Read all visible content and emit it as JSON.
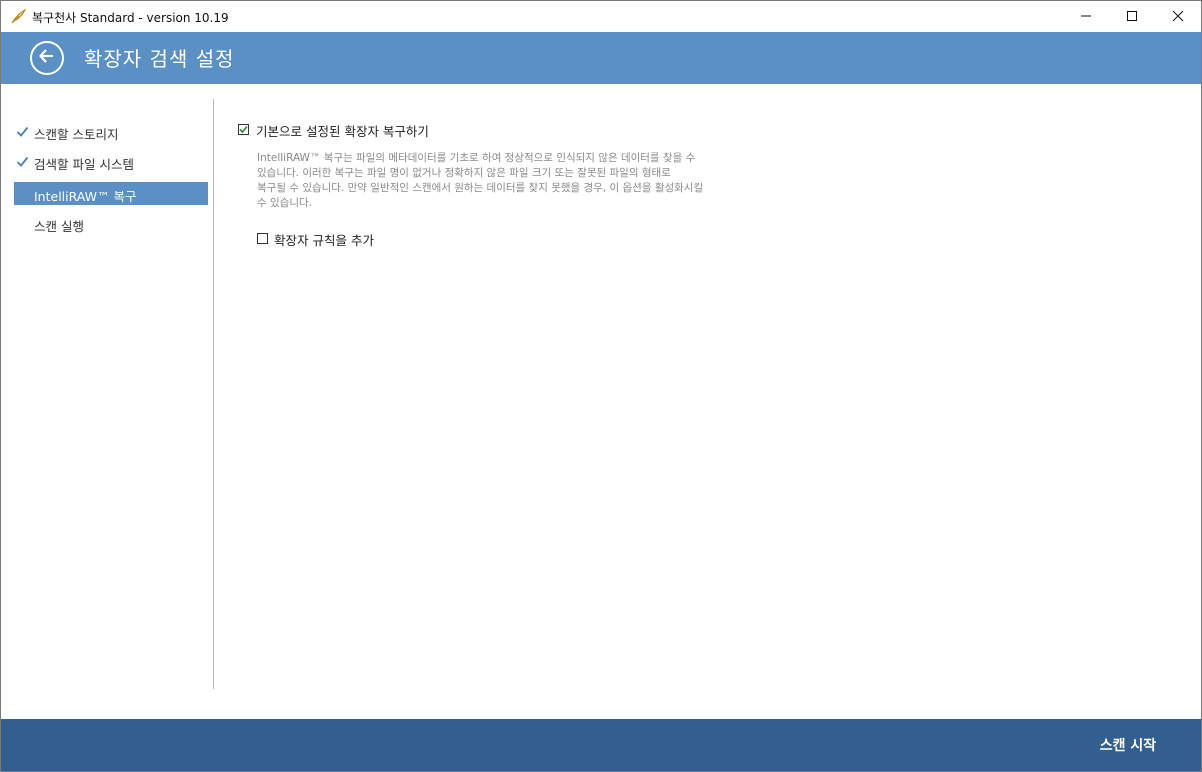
{
  "window": {
    "title": "복구천사 Standard - version 10.19",
    "app_icon": "feather-icon",
    "controls": [
      "minimize-icon",
      "maximize-icon",
      "close-icon"
    ]
  },
  "header": {
    "back_icon": "back-arrow-icon",
    "title": "확장자 검색 설정"
  },
  "sidebar": {
    "items": [
      {
        "label": "스캔할 스토리지",
        "state": "done",
        "icon": "checkmark-icon"
      },
      {
        "label": "검색할 파일 시스템",
        "state": "done",
        "icon": "checkmark-icon"
      },
      {
        "label": "IntelliRAW™ 복구",
        "state": "active"
      },
      {
        "label": "스캔 실행",
        "state": "pending"
      }
    ]
  },
  "main": {
    "default_recovery": {
      "label": "기본으로 설정된 확장자 복구하기",
      "checked": true
    },
    "description": [
      "IntelliRAW™ 복구는 파일의 메타데이터를 기초로 하여 정상적으로 인식되지 않은 데이터를 찾을 수",
      "있습니다. 이러한 복구는 파일 명이 없거나 정확하지 않은 파일 크기 또는 잘못된 파일의 형태로",
      "복구될 수 있습니다. 만약 일반적인 스캔에서 원하는 데이터를 찾지 못했을 경우, 이 옵션을 활성화시킬",
      "수 있습니다."
    ],
    "add_rule": {
      "label": "확장자 규칙을 추가",
      "checked": false
    }
  },
  "footer": {
    "start_label": "스캔 시작"
  },
  "colors": {
    "header_bg": "#5a90c6",
    "footer_bg": "#325f8d",
    "active_item_bg": "#5a90c6",
    "check_color": "#4a80b8",
    "checkbox_check": "#2e8b2e"
  }
}
